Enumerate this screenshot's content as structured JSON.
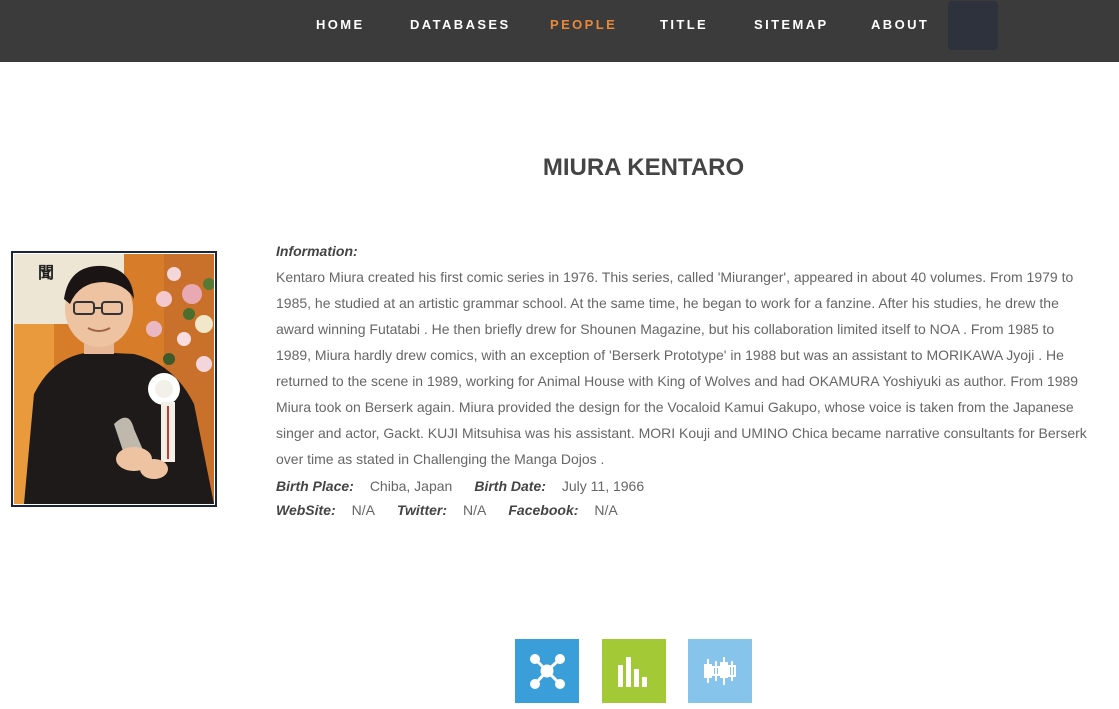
{
  "nav": {
    "items": [
      {
        "label": "HOME",
        "active": false
      },
      {
        "label": "DATABASES",
        "active": false
      },
      {
        "label": "PEOPLE",
        "active": true
      },
      {
        "label": "TITLE",
        "active": false
      },
      {
        "label": "SITEMAP",
        "active": false
      },
      {
        "label": "ABOUT",
        "active": false
      }
    ],
    "background": "#3b3b3b",
    "active_color": "#e8893a"
  },
  "page": {
    "title": "MIURA KENTARO"
  },
  "info": {
    "heading": "Information:",
    "bio": "Kentaro Miura created his first comic series in 1976. This series, called 'Miuranger', appeared in about 40 volumes. From 1979 to 1985, he studied at an artistic grammar school. At the same time, he began to work for a fanzine. After his studies, he drew the award winning Futatabi . He then briefly drew for Shounen Magazine, but his collaboration limited itself to NOA . From 1985 to 1989, Miura hardly drew comics, with an exception of 'Berserk Prototype' in 1988 but was an assistant to MORIKAWA Jyoji . He returned to the scene in 1989, working for Animal House with King of Wolves and had OKAMURA Yoshiyuki as author. From 1989 Miura took on Berserk again. Miura provided the design for the Vocaloid Kamui Gakupo, whose voice is taken from the Japanese singer and actor, Gackt. KUJI Mitsuhisa was his assistant. MORI Kouji and UMINO Chica became narrative consultants for Berserk over time as stated in Challenging the Manga Dojos ."
  },
  "details": {
    "birth_place_label": "Birth Place:",
    "birth_place": "Chiba, Japan",
    "birth_date_label": "Birth Date:",
    "birth_date": "July 11, 1966",
    "website_label": "WebSite:",
    "website": "N/A",
    "twitter_label": "Twitter:",
    "twitter": "N/A",
    "facebook_label": "Facebook:",
    "facebook": "N/A"
  },
  "icon_buttons": [
    {
      "icon": "network-graph-icon",
      "color": "#3a9fd9"
    },
    {
      "icon": "bar-chart-icon",
      "color": "#a4c936"
    },
    {
      "icon": "candlestick-chart-icon",
      "color": "#86c4eb"
    }
  ],
  "photo": {
    "signage_glyph": "聞"
  }
}
